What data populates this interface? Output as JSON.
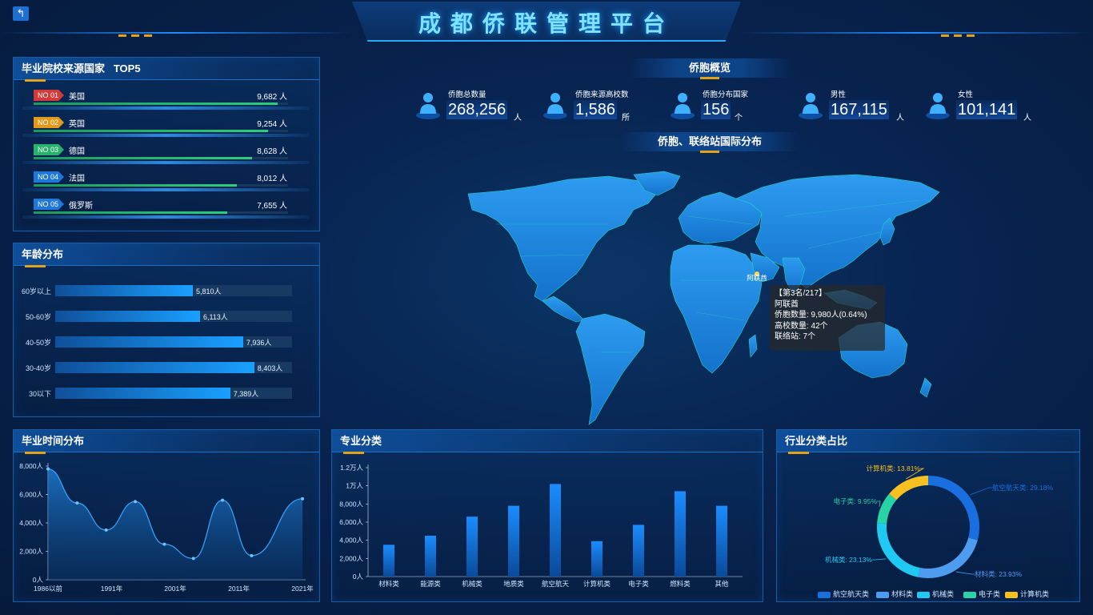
{
  "header": {
    "title": "成都侨联管理平台",
    "back_icon": "back-arrow-icon"
  },
  "top5": {
    "title": "毕业院校来源国家   TOP5",
    "items": [
      {
        "rank": "NO 01",
        "country": "美国",
        "value": "9,682 人",
        "color": "#d43a3a",
        "fraction": 0.96
      },
      {
        "rank": "NO 02",
        "country": "英国",
        "value": "9,254 人",
        "color": "#e39a1b",
        "fraction": 0.92
      },
      {
        "rank": "NO 03",
        "country": "德国",
        "value": "8,628 人",
        "color": "#27b26d",
        "fraction": 0.86
      },
      {
        "rank": "NO 04",
        "country": "法国",
        "value": "8,012 人",
        "color": "#1f78d8",
        "fraction": 0.8
      },
      {
        "rank": "NO 05",
        "country": "俄罗斯",
        "value": "7,655 人",
        "color": "#1f78d8",
        "fraction": 0.76
      }
    ]
  },
  "age": {
    "title": "年龄分布",
    "max": 10000,
    "items": [
      {
        "label": "60岁以上",
        "value": 5810,
        "display": "5,810人"
      },
      {
        "label": "50-60岁",
        "value": 6113,
        "display": "6,113人"
      },
      {
        "label": "40-50岁",
        "value": 7936,
        "display": "7,936人"
      },
      {
        "label": "30-40岁",
        "value": 8403,
        "display": "8,403人"
      },
      {
        "label": "30以下",
        "value": 7389,
        "display": "7,389人"
      }
    ]
  },
  "overview": {
    "title": "侨胞概览",
    "stats": [
      {
        "label": "侨胞总数量",
        "value": "268,256",
        "unit": "人",
        "icon": "person-icon"
      },
      {
        "label": "侨胞来源高校数",
        "value": "1,586",
        "unit": "所",
        "icon": "school-icon"
      },
      {
        "label": "侨胞分布国家",
        "value": "156",
        "unit": "个",
        "icon": "flag-icon"
      },
      {
        "label": "男性",
        "value": "167,115",
        "unit": "人",
        "icon": "male-icon"
      },
      {
        "label": "女性",
        "value": "101,141",
        "unit": "人",
        "icon": "female-icon"
      }
    ]
  },
  "map": {
    "title": "侨胞、联络站国际分布",
    "marker_label": "阿联酋",
    "tooltip": {
      "line1": "【第3名/217】",
      "line2": "阿联酋",
      "line3": "侨胞数量: 9,980人(0.64%)",
      "line4": "高校数量: 42个",
      "line5": "联络站: 7个"
    }
  },
  "graduation": {
    "title": "毕业时间分布",
    "chart_data": {
      "type": "area",
      "x": [
        1986,
        1990,
        1994,
        1998,
        2002,
        2006,
        2010,
        2014,
        2021
      ],
      "y": [
        7800,
        5400,
        3500,
        5500,
        2500,
        1500,
        5600,
        1700,
        5700
      ],
      "x_tick_labels": [
        "1986以前",
        "1991年",
        "2001年",
        "2011年",
        "2021年"
      ],
      "y_tick_labels": [
        "0人",
        "2,000人",
        "4,000人",
        "6,000人",
        "8,000人"
      ],
      "ylim": [
        0,
        8000
      ]
    }
  },
  "major": {
    "title": "专业分类",
    "chart_data": {
      "type": "bar",
      "categories": [
        "材料类",
        "能源类",
        "机械类",
        "地质类",
        "航空航天",
        "计算机类",
        "电子类",
        "燃料类",
        "其他"
      ],
      "values": [
        3500,
        4500,
        6600,
        7800,
        10200,
        3900,
        5700,
        9400,
        7800
      ],
      "y_tick_labels": [
        "0人",
        "2,000人",
        "4,000人",
        "6,000人",
        "8,000人",
        "1万人",
        "1.2万人"
      ],
      "ylim": [
        0,
        12000
      ]
    }
  },
  "industry": {
    "title": "行业分类占比",
    "chart_data": {
      "type": "pie",
      "slices": [
        {
          "name": "航空航天类",
          "value": 29.18,
          "label": "航空航天类: 29.18%",
          "color": "#1a6fe0"
        },
        {
          "name": "材料类",
          "value": 23.93,
          "label": "材料类: 23.93%",
          "color": "#4e9cf0"
        },
        {
          "name": "机械类",
          "value": 23.13,
          "label": "机械类: 23.13%",
          "color": "#1fc9f2"
        },
        {
          "name": "电子类",
          "value": 9.95,
          "label": "电子类: 9.95%",
          "color": "#28d3a6"
        },
        {
          "name": "计算机类",
          "value": 13.81,
          "label": "计算机类: 13.81%",
          "color": "#f5c020"
        }
      ]
    }
  }
}
